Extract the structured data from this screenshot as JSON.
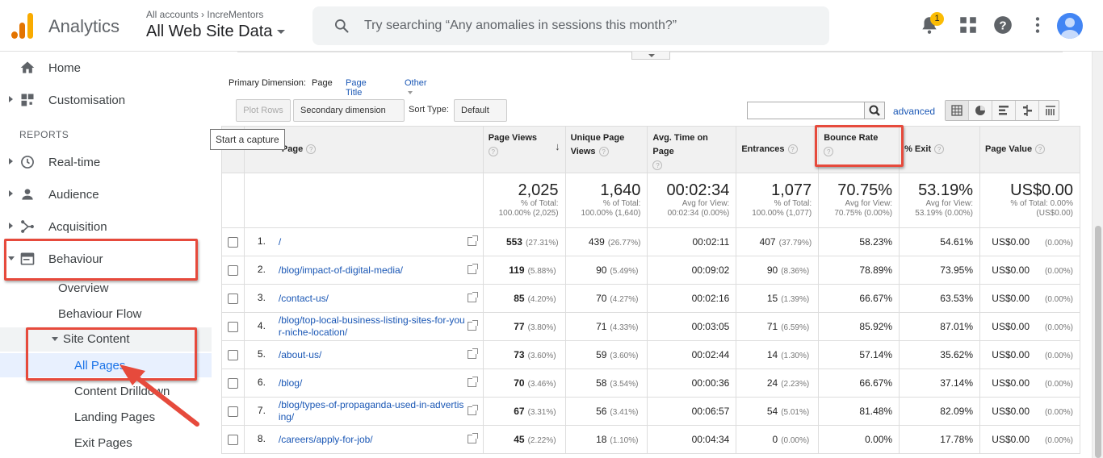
{
  "header": {
    "app_name": "Analytics",
    "account_crumb": "All accounts › IncreMentors",
    "view_name": "All Web Site Data",
    "search_placeholder": "Try searching “Any anomalies in sessions this month?”",
    "notification_count": "1",
    "icons": [
      "analytics-logo",
      "search-icon",
      "bell-icon",
      "apps-grid-icon",
      "help-icon",
      "more-vert-icon",
      "avatar"
    ]
  },
  "sidebar": {
    "home": "Home",
    "customisation": "Customisation",
    "reports_label": "REPORTS",
    "realtime": "Real-time",
    "audience": "Audience",
    "acquisition": "Acquisition",
    "behaviour": "Behaviour",
    "overview": "Overview",
    "behaviour_flow": "Behaviour Flow",
    "site_content": "Site Content",
    "all_pages": "All Pages",
    "content_drilldown": "Content Drilldown",
    "landing_pages": "Landing Pages",
    "exit_pages": "Exit Pages"
  },
  "controls": {
    "primary_dimension_label": "Primary Dimension:",
    "dim_page": "Page",
    "dim_page_title": "Page Title",
    "dim_other": "Other",
    "plot_rows": "Plot Rows",
    "secondary_dimension": "Secondary dimension",
    "sort_type_label": "Sort Type:",
    "sort_type_value": "Default",
    "advanced": "advanced",
    "tooltip": "Start a capture"
  },
  "table": {
    "headers": {
      "page": "Page",
      "page_views": "Page Views",
      "unique_page_views": "Unique Page Views",
      "avg_time": "Avg. Time on Page",
      "entrances": "Entrances",
      "bounce_rate": "Bounce Rate",
      "exit": "% Exit",
      "page_value": "Page Value"
    },
    "totals": {
      "page_views": "2,025",
      "page_views_sub1": "% of Total:",
      "page_views_sub2": "100.00% (2,025)",
      "unique": "1,640",
      "unique_sub1": "% of Total:",
      "unique_sub2": "100.00% (1,640)",
      "avg_time": "00:02:34",
      "avg_time_sub1": "Avg for View:",
      "avg_time_sub2": "00:02:34 (0.00%)",
      "entrances": "1,077",
      "entrances_sub1": "% of Total:",
      "entrances_sub2": "100.00% (1,077)",
      "bounce": "70.75%",
      "bounce_sub1": "Avg for View:",
      "bounce_sub2": "70.75% (0.00%)",
      "exit": "53.19%",
      "exit_sub1": "Avg for View:",
      "exit_sub2": "53.19% (0.00%)",
      "value": "US$0.00",
      "value_sub1": "% of Total: 0.00%",
      "value_sub2": "(US$0.00)"
    },
    "rows": [
      {
        "idx": "1.",
        "page": "/",
        "pv": "553",
        "pv_pct": "(27.31%)",
        "upv": "439",
        "upv_pct": "(26.77%)",
        "time": "00:02:11",
        "ent": "407",
        "ent_pct": "(37.79%)",
        "bounce": "58.23%",
        "exit": "54.61%",
        "value": "US$0.00",
        "value_pct": "(0.00%)"
      },
      {
        "idx": "2.",
        "page": "/blog/impact-of-digital-media/",
        "pv": "119",
        "pv_pct": "(5.88%)",
        "upv": "90",
        "upv_pct": "(5.49%)",
        "time": "00:09:02",
        "ent": "90",
        "ent_pct": "(8.36%)",
        "bounce": "78.89%",
        "exit": "73.95%",
        "value": "US$0.00",
        "value_pct": "(0.00%)"
      },
      {
        "idx": "3.",
        "page": "/contact-us/",
        "pv": "85",
        "pv_pct": "(4.20%)",
        "upv": "70",
        "upv_pct": "(4.27%)",
        "time": "00:02:16",
        "ent": "15",
        "ent_pct": "(1.39%)",
        "bounce": "66.67%",
        "exit": "63.53%",
        "value": "US$0.00",
        "value_pct": "(0.00%)"
      },
      {
        "idx": "4.",
        "page": "/blog/top-local-business-listing-sites-for-your-niche-location/",
        "pv": "77",
        "pv_pct": "(3.80%)",
        "upv": "71",
        "upv_pct": "(4.33%)",
        "time": "00:03:05",
        "ent": "71",
        "ent_pct": "(6.59%)",
        "bounce": "85.92%",
        "exit": "87.01%",
        "value": "US$0.00",
        "value_pct": "(0.00%)"
      },
      {
        "idx": "5.",
        "page": "/about-us/",
        "pv": "73",
        "pv_pct": "(3.60%)",
        "upv": "59",
        "upv_pct": "(3.60%)",
        "time": "00:02:44",
        "ent": "14",
        "ent_pct": "(1.30%)",
        "bounce": "57.14%",
        "exit": "35.62%",
        "value": "US$0.00",
        "value_pct": "(0.00%)"
      },
      {
        "idx": "6.",
        "page": "/blog/",
        "pv": "70",
        "pv_pct": "(3.46%)",
        "upv": "58",
        "upv_pct": "(3.54%)",
        "time": "00:00:36",
        "ent": "24",
        "ent_pct": "(2.23%)",
        "bounce": "66.67%",
        "exit": "37.14%",
        "value": "US$0.00",
        "value_pct": "(0.00%)"
      },
      {
        "idx": "7.",
        "page": "/blog/types-of-propaganda-used-in-advertising/",
        "pv": "67",
        "pv_pct": "(3.31%)",
        "upv": "56",
        "upv_pct": "(3.41%)",
        "time": "00:06:57",
        "ent": "54",
        "ent_pct": "(5.01%)",
        "bounce": "81.48%",
        "exit": "82.09%",
        "value": "US$0.00",
        "value_pct": "(0.00%)"
      },
      {
        "idx": "8.",
        "page": "/careers/apply-for-job/",
        "pv": "45",
        "pv_pct": "(2.22%)",
        "upv": "18",
        "upv_pct": "(1.10%)",
        "time": "00:04:34",
        "ent": "0",
        "ent_pct": "(0.00%)",
        "bounce": "0.00%",
        "exit": "17.78%",
        "value": "US$0.00",
        "value_pct": "(0.00%)"
      }
    ]
  },
  "colors": {
    "accent_blue": "#1a57b5",
    "highlight_red": "#e64a3c",
    "logo_orange": "#e37400",
    "logo_yellow": "#f9ab00"
  }
}
